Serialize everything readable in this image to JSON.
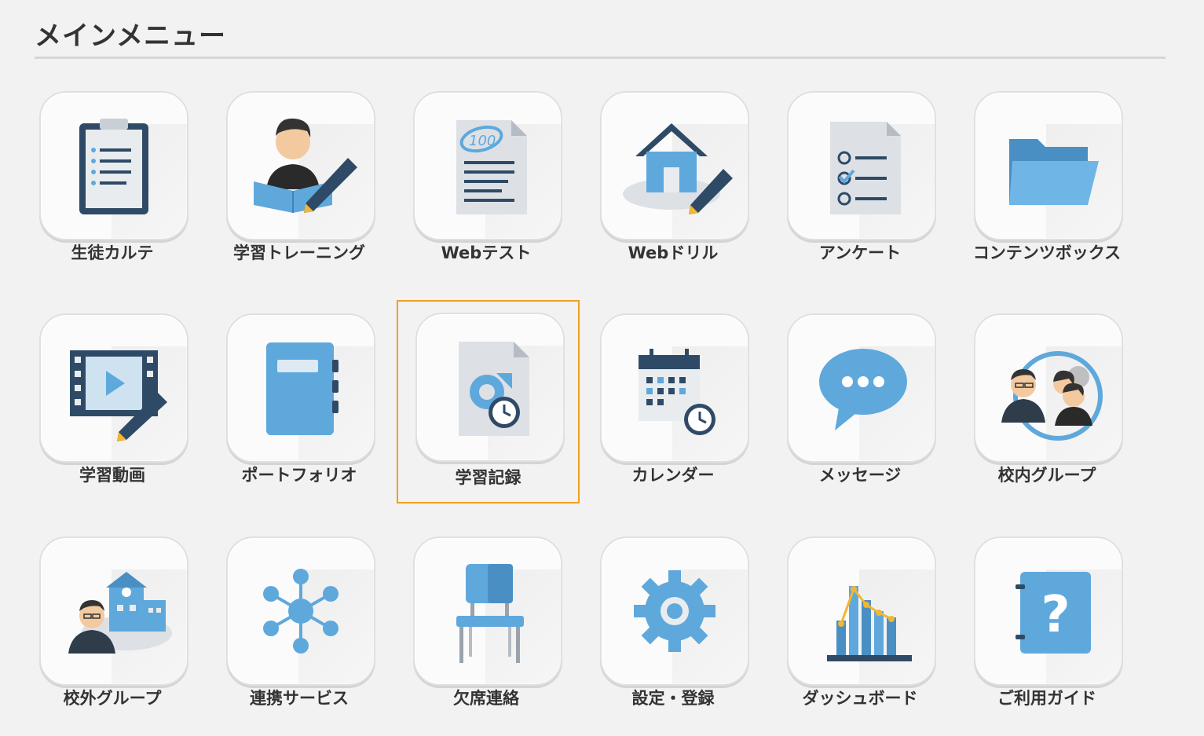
{
  "page": {
    "title": "メインメニュー"
  },
  "menu": {
    "items": [
      {
        "label": "生徒カルテ",
        "icon": "clipboard-icon"
      },
      {
        "label": "学習トレーニング",
        "icon": "student-reading-pencil-icon"
      },
      {
        "label": "Webテスト",
        "icon": "test-paper-100-icon"
      },
      {
        "label": "Webドリル",
        "icon": "house-pencil-icon"
      },
      {
        "label": "アンケート",
        "icon": "checklist-icon"
      },
      {
        "label": "コンテンツボックス",
        "icon": "folder-icon"
      },
      {
        "label": "学習動画",
        "icon": "film-pencil-icon"
      },
      {
        "label": "ポートフォリオ",
        "icon": "notebook-icon"
      },
      {
        "label": "学習記録",
        "icon": "document-clock-icon",
        "selected": true
      },
      {
        "label": "カレンダー",
        "icon": "calendar-clock-icon"
      },
      {
        "label": "メッセージ",
        "icon": "speech-bubble-icon"
      },
      {
        "label": "校内グループ",
        "icon": "people-group-icon"
      },
      {
        "label": "校外グループ",
        "icon": "teacher-school-icon"
      },
      {
        "label": "連携サービス",
        "icon": "network-icon"
      },
      {
        "label": "欠席連絡",
        "icon": "chair-icon"
      },
      {
        "label": "設定・登録",
        "icon": "gear-icon"
      },
      {
        "label": "ダッシュボード",
        "icon": "bar-line-chart-icon"
      },
      {
        "label": "ご利用ガイド",
        "icon": "question-book-icon"
      }
    ]
  },
  "colors": {
    "accent": "#f0a020",
    "icon_blue": "#5fa8dc",
    "icon_dark": "#2f4a66"
  }
}
